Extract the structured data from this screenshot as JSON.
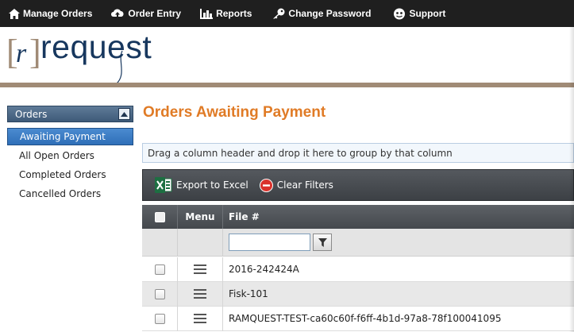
{
  "nav": {
    "items": [
      {
        "label": "Manage Orders",
        "icon": "home-icon"
      },
      {
        "label": "Order Entry",
        "icon": "cloud-upload-icon"
      },
      {
        "label": "Reports",
        "icon": "bar-chart-icon"
      },
      {
        "label": "Change Password",
        "icon": "key-icon"
      },
      {
        "label": "Support",
        "icon": "support-icon"
      }
    ]
  },
  "logo": {
    "bracket_text": "[r]",
    "word": "request"
  },
  "sidebar": {
    "header": "Orders",
    "items": [
      {
        "label": "Awaiting Payment",
        "active": true
      },
      {
        "label": "All Open Orders",
        "active": false
      },
      {
        "label": "Completed Orders",
        "active": false
      },
      {
        "label": "Cancelled Orders",
        "active": false
      }
    ]
  },
  "main": {
    "title": "Orders Awaiting Payment",
    "group_hint": "Drag a column header and drop it here to group by that column",
    "toolbar": {
      "export_label": "Export to Excel",
      "clear_label": "Clear Filters"
    },
    "grid": {
      "columns": [
        "Menu",
        "File #"
      ],
      "filter_value": "",
      "rows": [
        {
          "file": "2016-242424A"
        },
        {
          "file": "Fisk-101"
        },
        {
          "file": "RAMQUEST-TEST-ca60c60f-f6ff-4b1d-97a8-78f100041095"
        }
      ]
    }
  },
  "colors": {
    "accent": "#e07b26",
    "nav_bg": "#1f1f1f",
    "sidebar_active": "#2f6fb8",
    "logo": "#17375e"
  }
}
